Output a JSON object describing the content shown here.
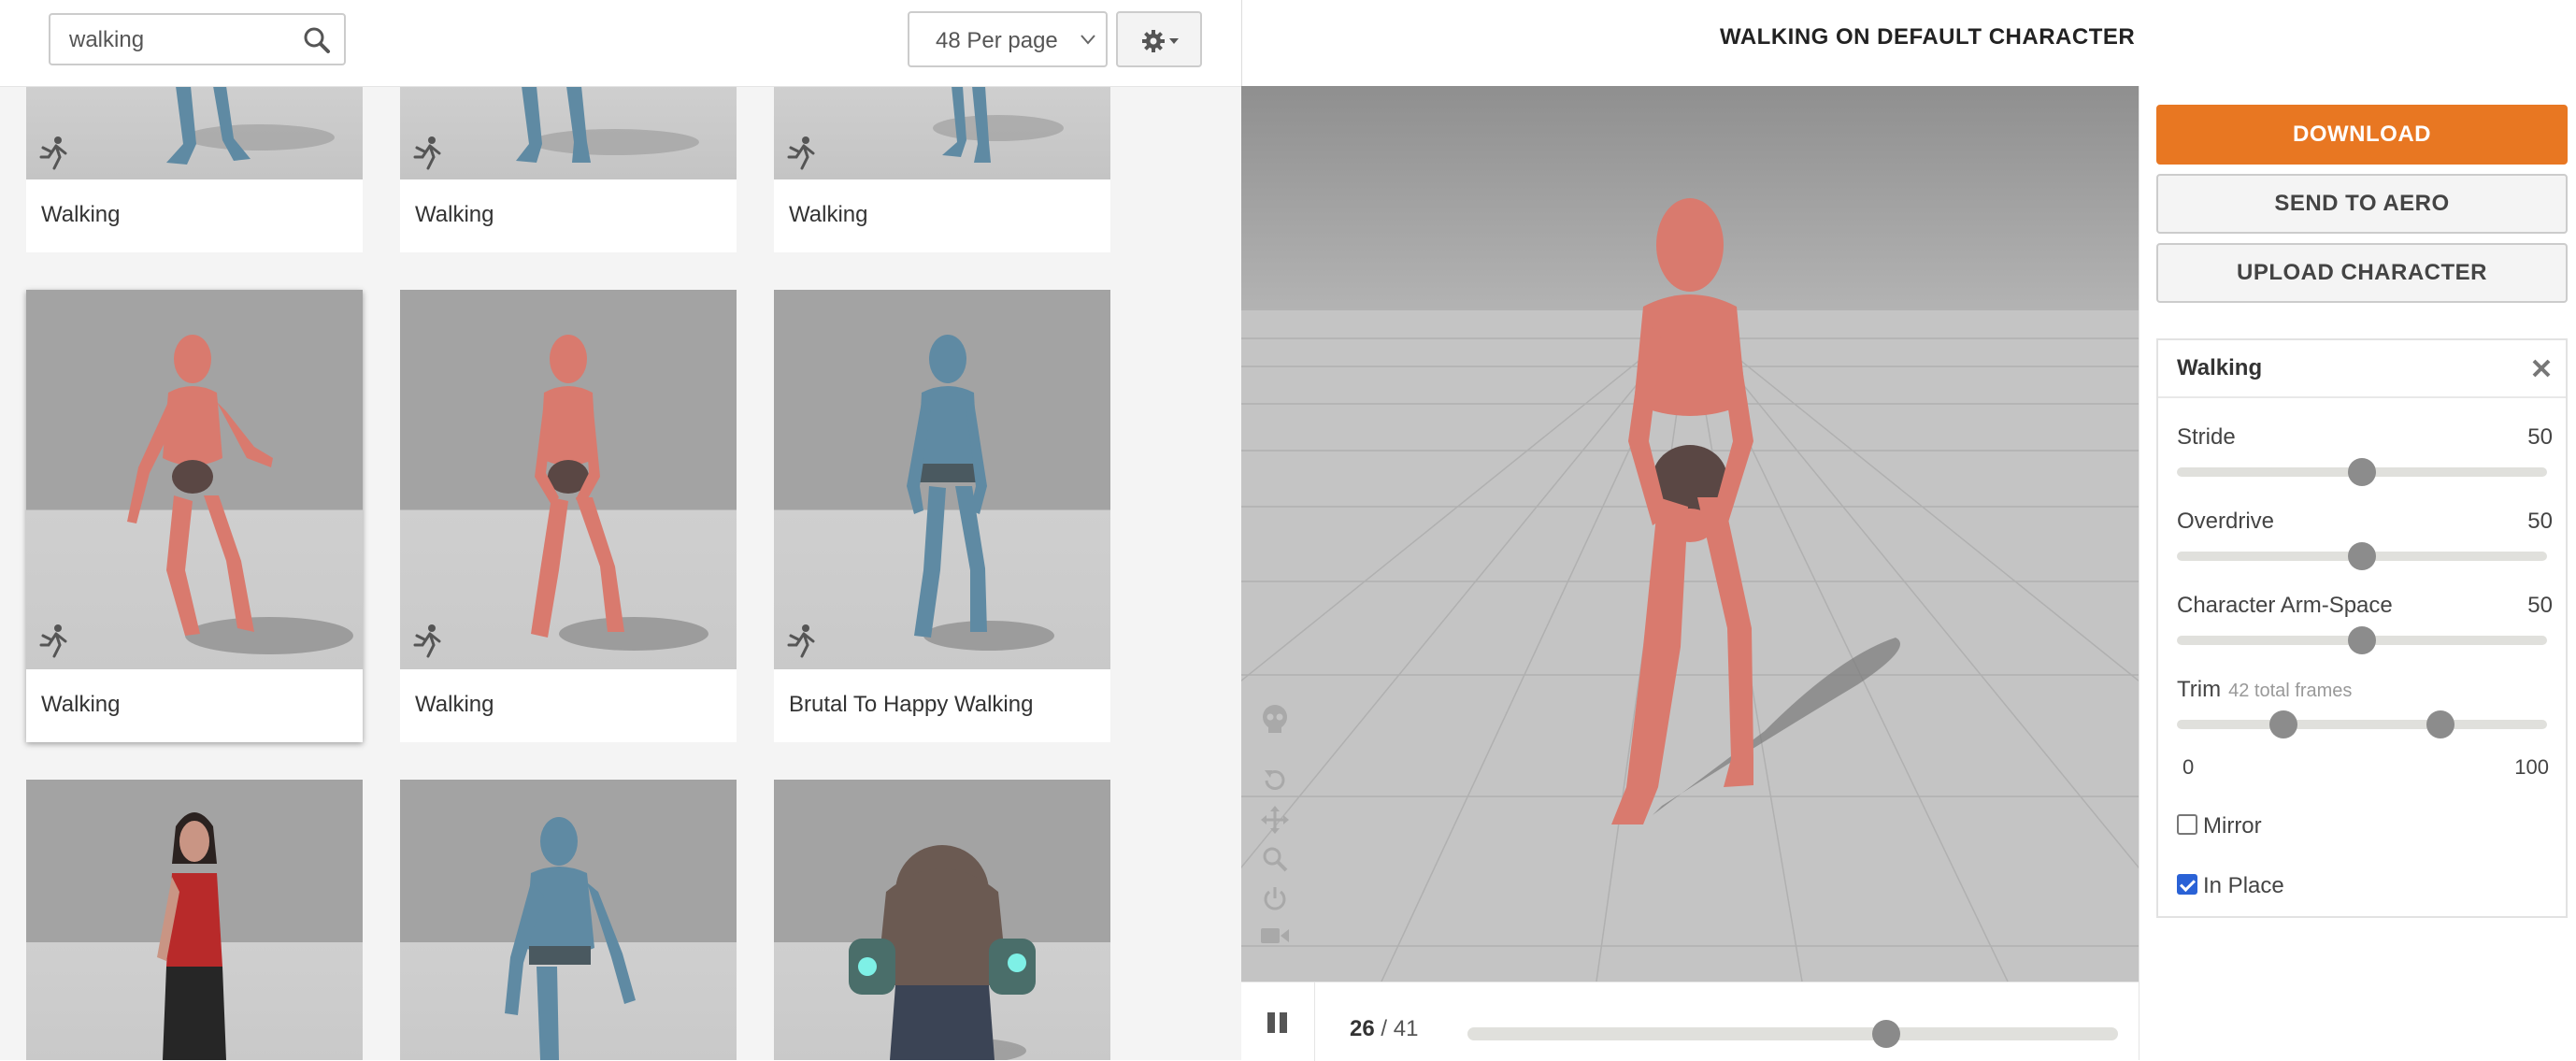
{
  "search": {
    "value": "walking"
  },
  "per_page": {
    "label": "48 Per page"
  },
  "grid": {
    "cards": [
      {
        "label": "Walking"
      },
      {
        "label": "Walking"
      },
      {
        "label": "Walking"
      },
      {
        "label": "Walking"
      },
      {
        "label": "Walking"
      },
      {
        "label": "Brutal To Happy Walking"
      }
    ]
  },
  "viewer": {
    "title": "WALKING ON DEFAULT CHARACTER",
    "current_frame": "26",
    "frame_sep": " / ",
    "total_frames": "41",
    "progress": 0.65
  },
  "actions": {
    "download": "DOWNLOAD",
    "send": "SEND TO AERO",
    "upload": "UPLOAD CHARACTER"
  },
  "settings": {
    "title": "Walking",
    "stride": {
      "label": "Stride",
      "value": "50"
    },
    "overdrive": {
      "label": "Overdrive",
      "value": "50"
    },
    "arm_space": {
      "label": "Character Arm-Space",
      "value": "50"
    },
    "trim": {
      "label": "Trim",
      "sub": "42 total frames",
      "min": "0",
      "max": "100",
      "low": 0.27,
      "high": 0.73
    },
    "mirror": {
      "label": "Mirror",
      "checked": false
    },
    "in_place": {
      "label": "In Place",
      "checked": true
    }
  },
  "colors": {
    "accent": "#e87722",
    "checkbox": "#2a62d6",
    "character": "#d97a6e",
    "alt_character": "#5f8aa3"
  }
}
